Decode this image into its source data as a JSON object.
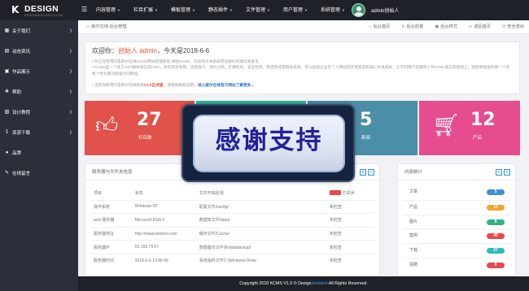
{
  "header": {
    "logo_text": "DESIGN",
    "logo_mark": "K",
    "logo_sub": "DESIGN.KELVINVT.COM",
    "menu_icon": "hamburger-icon",
    "nav": [
      {
        "label": "内容管理"
      },
      {
        "label": "栏目扩展"
      },
      {
        "label": "模板管理"
      },
      {
        "label": "静态插件"
      },
      {
        "label": "文件管理"
      },
      {
        "label": "用户管理"
      },
      {
        "label": "系统管理"
      }
    ],
    "user_name": "admin创始人"
  },
  "sidebar": {
    "items": [
      {
        "label": "关于我们",
        "icon": "document-icon"
      },
      {
        "label": "动态资讯",
        "icon": "news-icon"
      },
      {
        "label": "作品展示",
        "icon": "gallery-icon"
      },
      {
        "label": "帮助",
        "icon": "help-icon"
      },
      {
        "label": "设计教程",
        "icon": "book-icon"
      },
      {
        "label": "资源下载",
        "icon": "download-icon"
      },
      {
        "label": "品牌",
        "icon": "brand-icon"
      },
      {
        "label": "在线留言",
        "icon": "message-icon"
      }
    ]
  },
  "toolbar": {
    "breadcrumb": "就尔在线-后台管理",
    "tools": [
      "后台首页",
      "后台前置",
      "后台样式",
      "返回首页",
      "安全退出"
    ]
  },
  "welcome": {
    "greeting_prefix": "欢迎你：",
    "greeting_user": "创始人 admin",
    "greeting_suffix": "，今天是2018-6-6",
    "lines": [
      "• 你正在使用的是就尔在线KCMS网站管理系统,请给KCMS，欢迎你对本系统提出要好的建议和意见。",
      "• KCMS是一个基于ASP脚本语言的CMS，具有简单易用、功能强大、性价比高、扩展性好，安全性高，稳定性好等网站系统，可以加快企业及个人网站的开发速度和减少开发成本，让不同用户在懂的少许HTML语言的基础上，就能够快速构建一个风格个性化而功能强大的网站。"
    ],
    "version_prefix": "• 当前你使用的是就尔在线系统",
    "version": "V1.0正式版",
    "version_mid": "，请保留版权说明。",
    "version_link": "进入就尔在线官方网站了解更多..."
  },
  "stats": [
    {
      "number": "27",
      "label": "栏目数",
      "color": "#e0524a",
      "icon": "thumbs-up-icon"
    },
    {
      "number": "",
      "label": "",
      "color": "#2fb89a",
      "icon": "doc-icon"
    },
    {
      "number": "5",
      "label": "新闻",
      "color": "#4b8ea8",
      "icon": "news-icon"
    },
    {
      "number": "12",
      "label": "产品",
      "color": "#e54d8f",
      "icon": "cart-icon"
    }
  ],
  "server_panel": {
    "title": "服务器与文件夹信息",
    "rows": [
      {
        "c1": "项目",
        "c2": "状态",
        "c3": "文件开启检测",
        "c4": "已关闭",
        "switch": true
      },
      {
        "c1": "操作系统",
        "c2": "Windows NT",
        "c3": "配置文件/config/",
        "c4": "未检查"
      },
      {
        "c1": "web 服务器",
        "c2": "Microsoft-IIS/6.0",
        "c3": "数据库文件/data/",
        "c4": "未检查"
      },
      {
        "c1": "服务器地址",
        "c2": "http://www.kelvinvt.com",
        "c3": "缓存文件/Cache/",
        "c4": "未检查"
      },
      {
        "c1": "服务器IP",
        "c2": "60.169.79.67",
        "c3": "数据备份文件夹/databackup/",
        "c4": "未检查"
      },
      {
        "c1": "服务器时间",
        "c2": "2018-6-6 13:46:49",
        "c3": "系统临时文件C:\\Windows\\Temp",
        "c4": "未检查"
      }
    ]
  },
  "content_panel": {
    "title": "内容统计",
    "rows": [
      {
        "label": "文章",
        "value": "5",
        "color": "#3d8fd8"
      },
      {
        "label": "产品",
        "value": "12",
        "color": "#f0a532"
      },
      {
        "label": "图片",
        "value": "8",
        "color": "#2fb37f"
      },
      {
        "label": "案例",
        "value": "40",
        "color": "#e8474a"
      },
      {
        "label": "下载",
        "value": "27",
        "color": "#2fb8c0"
      },
      {
        "label": "招聘",
        "value": "0",
        "color": "#e8474a"
      }
    ]
  },
  "footer": {
    "prefix": "Copyright 2018 KCMS V1.0 © Design.",
    "link": "Kelvinvt",
    "suffix": " All Rights Reserved."
  },
  "overlay": {
    "text": "感谢支持"
  }
}
